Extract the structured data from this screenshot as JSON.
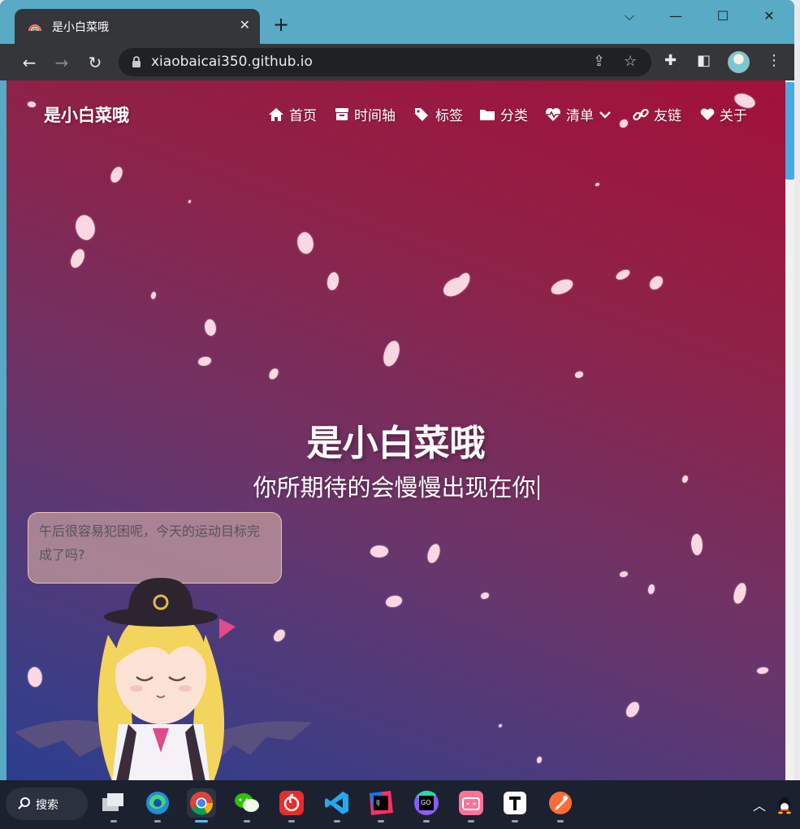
{
  "browser": {
    "tab_title": "是小白菜哦",
    "tab_close": "✕",
    "new_tab": "+",
    "url": "xiaobaicai350.github.io",
    "win_controls": {
      "dropdown": "⌵",
      "minimize": "—",
      "maximize": "☐",
      "close": "✕"
    }
  },
  "site": {
    "brand": "是小白菜哦",
    "nav": [
      {
        "label": "首页",
        "icon": "home-icon"
      },
      {
        "label": "时间轴",
        "icon": "archive-icon"
      },
      {
        "label": "标签",
        "icon": "tags-icon"
      },
      {
        "label": "分类",
        "icon": "folder-icon"
      },
      {
        "label": "清单",
        "icon": "heartbeat-icon"
      },
      {
        "label": "友链",
        "icon": "link-icon"
      },
      {
        "label": "关于",
        "icon": "heart-icon"
      }
    ],
    "hero_title": "是小白菜哦",
    "hero_subtitle": "你所期待的会慢慢出现在你",
    "mascot_message": "午后很容易犯困呢，今天的运动目标完成了吗?"
  },
  "taskbar": {
    "search_label": "搜索",
    "apps": [
      "task-view",
      "edge",
      "chrome",
      "wechat",
      "netease-music",
      "vscode",
      "intellij-idea",
      "goland",
      "bilibili",
      "typora",
      "postman"
    ],
    "active_app": "chrome"
  },
  "colors": {
    "page_gradient_top": "#a3113a",
    "page_gradient_bottom": "#2c3d8f",
    "titlebar": "#58aac5",
    "toolbar": "#35363a",
    "petal": "#fbd7e2"
  }
}
